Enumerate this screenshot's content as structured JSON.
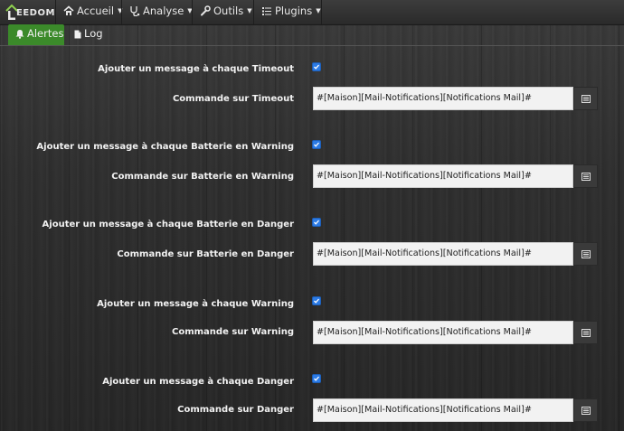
{
  "brand": {
    "name": "EEDOM",
    "logo_icon": "house-logo-icon"
  },
  "nav": [
    {
      "label": "Accueil",
      "icon": "home-icon"
    },
    {
      "label": "Analyse",
      "icon": "stethoscope-icon"
    },
    {
      "label": "Outils",
      "icon": "wrench-icon"
    },
    {
      "label": "Plugins",
      "icon": "list-icon"
    }
  ],
  "tabs": [
    {
      "label": "Alertes",
      "icon": "bell-icon",
      "active": true
    },
    {
      "label": "Log",
      "icon": "file-icon",
      "active": false
    }
  ],
  "form": [
    {
      "checkbox_label": "Ajouter un message à chaque Timeout",
      "checked": true,
      "command_label": "Commande sur Timeout",
      "command_value": "#[Maison][Mail-Notifications][Notifications Mail]#"
    },
    {
      "checkbox_label": "Ajouter un message à chaque Batterie en Warning",
      "checked": true,
      "command_label": "Commande sur Batterie en Warning",
      "command_value": "#[Maison][Mail-Notifications][Notifications Mail]#"
    },
    {
      "checkbox_label": "Ajouter un message à chaque Batterie en Danger",
      "checked": true,
      "command_label": "Commande sur Batterie en Danger",
      "command_value": "#[Maison][Mail-Notifications][Notifications Mail]#"
    },
    {
      "checkbox_label": "Ajouter un message à chaque Warning",
      "checked": true,
      "command_label": "Commande sur Warning",
      "command_value": "#[Maison][Mail-Notifications][Notifications Mail]#"
    },
    {
      "checkbox_label": "Ajouter un message à chaque Danger",
      "checked": true,
      "command_label": "Commande sur Danger",
      "command_value": "#[Maison][Mail-Notifications][Notifications Mail]#"
    }
  ],
  "colors": {
    "active_tab": "#3b8a2a",
    "checkbox": "#2c7be5",
    "navbar": "#2f2f2f"
  }
}
